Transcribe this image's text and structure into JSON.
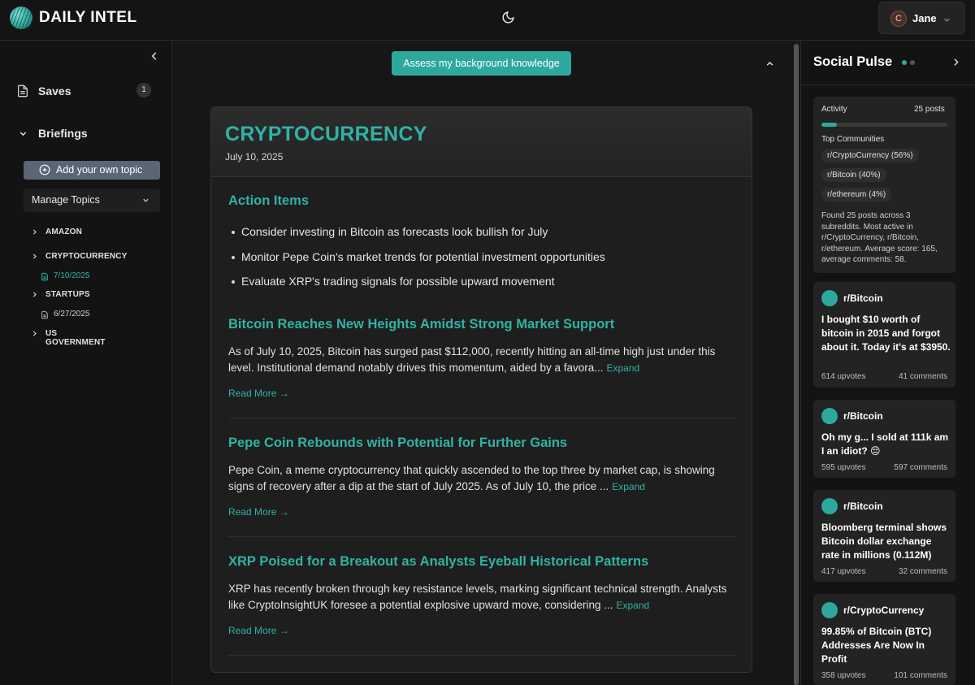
{
  "header": {
    "brand": "DAILY INTEL",
    "user_initial": "C",
    "user_name": "Jane"
  },
  "sidebar": {
    "saves_label": "Saves",
    "saves_count": "1",
    "briefings_label": "Briefings",
    "add_topic_label": "Add your own topic",
    "manage_topics_label": "Manage Topics",
    "topics": [
      {
        "name": "AMAZON"
      },
      {
        "name": "CRYPTOCURRENCY",
        "date": "7/10/2025"
      },
      {
        "name": "STARTUPS",
        "date": "6/27/2025"
      },
      {
        "name": "US GOVERNMENT"
      }
    ]
  },
  "main": {
    "assess_button": "Assess my background knowledge",
    "card_title": "CRYPTOCURRENCY",
    "card_date": "July 10, 2025",
    "action_items_title": "Action Items",
    "action_items": [
      "Consider investing in Bitcoin as forecasts look bullish for July",
      "Monitor Pepe Coin's market trends for potential investment opportunities",
      "Evaluate XRP's trading signals for possible upward movement"
    ],
    "expand_label": "Expand",
    "read_more_label": "Read More →",
    "articles": [
      {
        "title": "Bitcoin Reaches New Heights Amidst Strong Market Support",
        "summary": "As of July 10, 2025, Bitcoin has surged past $112,000, recently hitting an all-time high just under this level. Institutional demand notably drives this momentum, aided by a favora..."
      },
      {
        "title": "Pepe Coin Rebounds with Potential for Further Gains",
        "summary": "Pepe Coin, a meme cryptocurrency that quickly ascended to the top three by market cap, is showing signs of recovery after a dip at the start of July 2025. As of July 10, the price ..."
      },
      {
        "title": "XRP Poised for a Breakout as Analysts Eyeball Historical Patterns",
        "summary": "XRP has recently broken through key resistance levels, marking significant technical strength. Analysts like CryptoInsightUK foresee a potential explosive upward move, considering ..."
      }
    ]
  },
  "social": {
    "title": "Social Pulse",
    "activity_label": "Activity",
    "activity_count": "25 posts",
    "activity_level": 0.12,
    "top_communities_label": "Top Communities",
    "communities": [
      "r/CryptoCurrency (56%)",
      "r/Bitcoin (40%)",
      "r/ethereum (4%)"
    ],
    "summary": "Found 25 posts across 3 subreddits. Most active in r/CryptoCurrency, r/Bitcoin, r/ethereum. Average score: 165, average comments: 58.",
    "posts": [
      {
        "subreddit": "r/Bitcoin",
        "text": "I bought $10 worth of bitcoin in 2015 and forgot about it. Today it's at $3950.",
        "upvotes": "614 upvotes",
        "comments": "41 comments"
      },
      {
        "subreddit": "r/Bitcoin",
        "text": "Oh my g... I sold at 111k am I an idiot? 😔",
        "upvotes": "595 upvotes",
        "comments": "597 comments"
      },
      {
        "subreddit": "r/Bitcoin",
        "text": "Bloomberg terminal shows Bitcoin dollar exchange rate in millions (0.112M)",
        "upvotes": "417 upvotes",
        "comments": "32 comments"
      },
      {
        "subreddit": "r/CryptoCurrency",
        "text": "99.85% of Bitcoin (BTC) Addresses Are Now In Profit",
        "upvotes": "358 upvotes",
        "comments": "101 comments"
      }
    ]
  },
  "colors": {
    "accent": "#2ea89c",
    "background": "#161616"
  }
}
